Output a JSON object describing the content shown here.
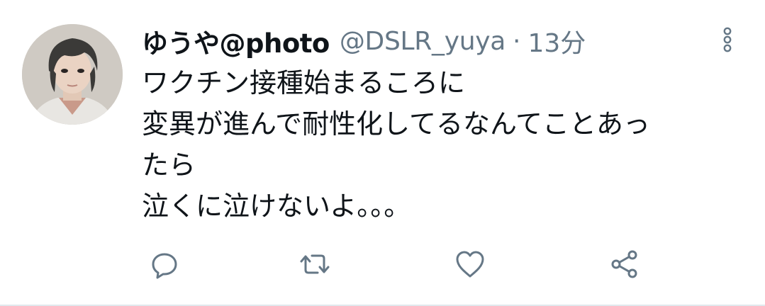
{
  "tweet": {
    "display_name": "ゆうや@photo",
    "handle": "@DSLR_yuya",
    "separator": "·",
    "time": "13分",
    "text_lines": [
      "ワクチン接種始まるころに",
      "変異が進んで耐性化してるなんてことあっ",
      "たら",
      "泣くに泣けないよ。。。"
    ]
  },
  "actions": [
    {
      "icon": "reply-icon"
    },
    {
      "icon": "retweet-icon"
    },
    {
      "icon": "like-icon"
    },
    {
      "icon": "share-icon"
    }
  ],
  "colors": {
    "text": "#0f1419",
    "secondary": "#657786",
    "icon": "#657786",
    "divider": "#e1e8ed"
  }
}
